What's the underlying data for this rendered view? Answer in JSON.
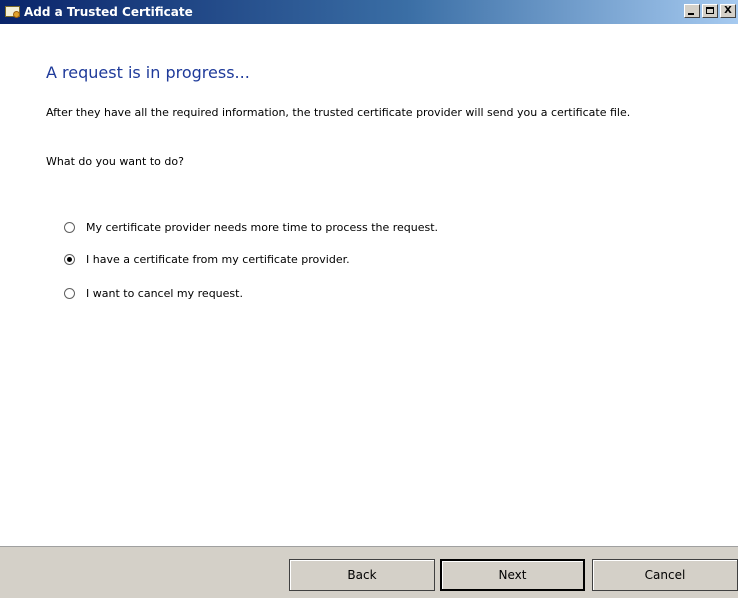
{
  "window": {
    "title": "Add a Trusted Certificate",
    "icon": "certificate-icon",
    "caption_buttons": [
      "minimize",
      "maximize",
      "close"
    ],
    "close_glyph": "X"
  },
  "page": {
    "heading": "A request is in progress...",
    "description": "After they have all the required information, the trusted certificate provider will send you a certificate file.",
    "question": "What do you want to do?"
  },
  "options": [
    {
      "label": "My certificate provider needs more time to process the request.",
      "checked": false
    },
    {
      "label": "I have a certificate from my certificate provider.",
      "checked": true
    },
    {
      "label": "I want to cancel my request.",
      "checked": false
    }
  ],
  "footer": {
    "back_label": "Back",
    "next_label": "Next",
    "cancel_label": "Cancel"
  },
  "colors": {
    "heading": "#1e3a9a",
    "titlebar_start": "#0a246a",
    "titlebar_end": "#a6caf0",
    "footer_bg": "#d4d0c8"
  }
}
